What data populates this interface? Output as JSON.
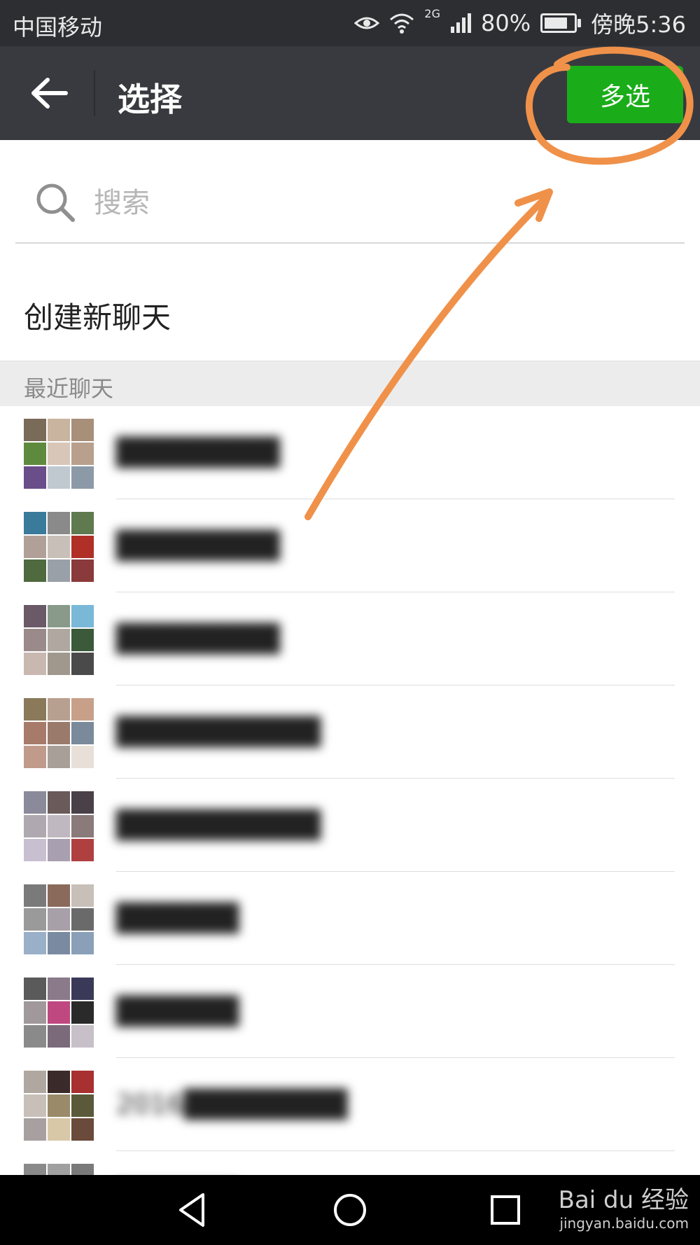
{
  "status_bar": {
    "carrier": "中国移动",
    "network": "2G",
    "battery": "80%",
    "battery_level": 0.8,
    "time": "傍晚5:36"
  },
  "header": {
    "title": "选择",
    "multi_select_label": "多选"
  },
  "search": {
    "placeholder": "搜索",
    "value": ""
  },
  "create_chat": {
    "label": "创建新聊天"
  },
  "recent": {
    "header": "最近聊天",
    "items": [
      {
        "name": "████████",
        "avatar_colors": [
          "#7a6a58",
          "#c9b4a0",
          "#a88f7a",
          "#5e8a3e",
          "#d8c6b8",
          "#b9a08c",
          "#6a4e8a",
          "#c0c8d0",
          "#8c9aa8"
        ]
      },
      {
        "name": "████████",
        "avatar_colors": [
          "#3a7a9a",
          "#8a8a8a",
          "#5e7a4e",
          "#b0a098",
          "#c8c0b8",
          "#b03028",
          "#4e6a3e",
          "#9aa0a8",
          "#8a3a3a"
        ]
      },
      {
        "name": "████████",
        "avatar_colors": [
          "#6a5a68",
          "#8a9a8a",
          "#7ab8d8",
          "#9a8a8a",
          "#b0a8a0",
          "#3a5a3a",
          "#c8b8b0",
          "#a0988c",
          "#4a4a4a"
        ]
      },
      {
        "name": "██████████",
        "avatar_colors": [
          "#8a7a5a",
          "#b8a090",
          "#c8a08a",
          "#a87a6a",
          "#9a7a6a",
          "#7a8a9a",
          "#c09a8a",
          "#a8a098",
          "#e8e0d8"
        ]
      },
      {
        "name": "██████████",
        "avatar_colors": [
          "#8a8a9a",
          "#6a5a5a",
          "#4a4048",
          "#b0a8b0",
          "#c0b8c0",
          "#8a7a7a",
          "#c8c0d0",
          "#a8a0b0",
          "#b04040"
        ]
      },
      {
        "name": "██████",
        "avatar_colors": [
          "#7a7a7a",
          "#8a6a5a",
          "#c8c0b8",
          "#9a9a9a",
          "#a8a0a8",
          "#6a6a6a",
          "#9ab0c8",
          "#7a8aa0",
          "#8aa0b8"
        ]
      },
      {
        "name": "██████",
        "avatar_colors": [
          "#5a5a5a",
          "#8a7a8a",
          "#3a3a58",
          "#a0989a",
          "#c04880",
          "#2a2a2a",
          "#8a8a8a",
          "#7a6a7a",
          "#c8c0c8"
        ]
      },
      {
        "name": "2016████████",
        "avatar_colors": [
          "#b0a8a0",
          "#3a2a2a",
          "#a83030",
          "#c8c0b8",
          "#9a8a6a",
          "#5a5a3a",
          "#a8a0a0",
          "#d8c8a8",
          "#6a4a3a"
        ]
      },
      {
        "name": "██████",
        "avatar_colors": [
          "#8a8a8a",
          "#a0a0a0",
          "#7a7a7a",
          "#b0b0b0",
          "#9a9a9a",
          "#8a8a8a",
          "#a8a8a8",
          "#9a9a9a",
          "#b8b8b8"
        ]
      }
    ]
  },
  "watermark": {
    "main": "Bai du 经验",
    "sub": "jingyan.baidu.com"
  },
  "colors": {
    "status_bg": "#2d2e32",
    "title_bg": "#393a3f",
    "accent_green": "#1aad19",
    "annotation_orange": "#f0914a"
  }
}
